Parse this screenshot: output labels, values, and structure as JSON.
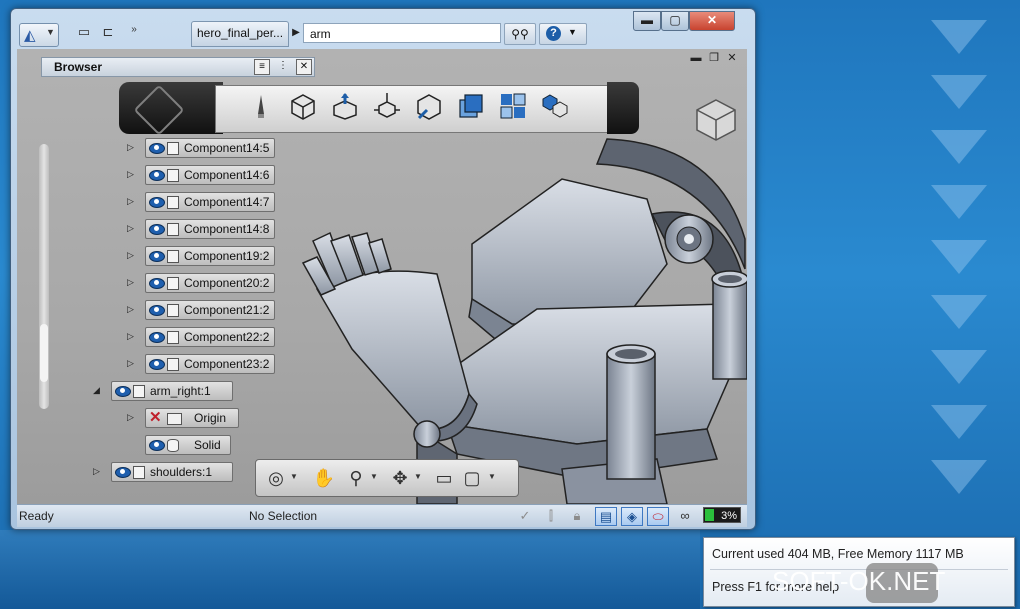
{
  "window": {
    "doc_tab": "hero_final_per...",
    "search_value": "arm",
    "controls": {
      "minimize": "▬",
      "maximize": "▢",
      "close": "✕"
    }
  },
  "browser": {
    "title": "Browser",
    "items": [
      {
        "label": "Component14:5"
      },
      {
        "label": "Component14:6"
      },
      {
        "label": "Component14:7"
      },
      {
        "label": "Component14:8"
      },
      {
        "label": "Component19:2"
      },
      {
        "label": "Component20:2"
      },
      {
        "label": "Component21:2"
      },
      {
        "label": "Component22:2"
      },
      {
        "label": "Component23:2"
      },
      {
        "label": "arm_right:1"
      },
      {
        "label": "Origin"
      },
      {
        "label": "Solid"
      },
      {
        "label": "shoulders:1"
      }
    ]
  },
  "top_toolbar": {
    "icons": [
      "sketch-pencil-icon",
      "box-icon",
      "extrude-icon",
      "move-icon",
      "inspect-icon",
      "window-icon",
      "grid-icon",
      "assembly-icon"
    ]
  },
  "bottom_toolbar": {
    "icons": [
      "orbit-icon",
      "pan-hand-icon",
      "zoom-icon",
      "pivot-icon",
      "views-icon",
      "display-icon"
    ]
  },
  "status": {
    "ready": "Ready",
    "selection": "No Selection",
    "memory": "3%"
  },
  "tooltip": {
    "line1": "Current used 404 MB, Free Memory 1117 MB",
    "line2": "Press F1 for more help"
  },
  "watermark": {
    "text": "SOFT-OK.NET"
  },
  "colors": {
    "desktop": "#1f76bd",
    "accent": "#1d5ea8",
    "memory_fill": "#2bbf3c"
  }
}
